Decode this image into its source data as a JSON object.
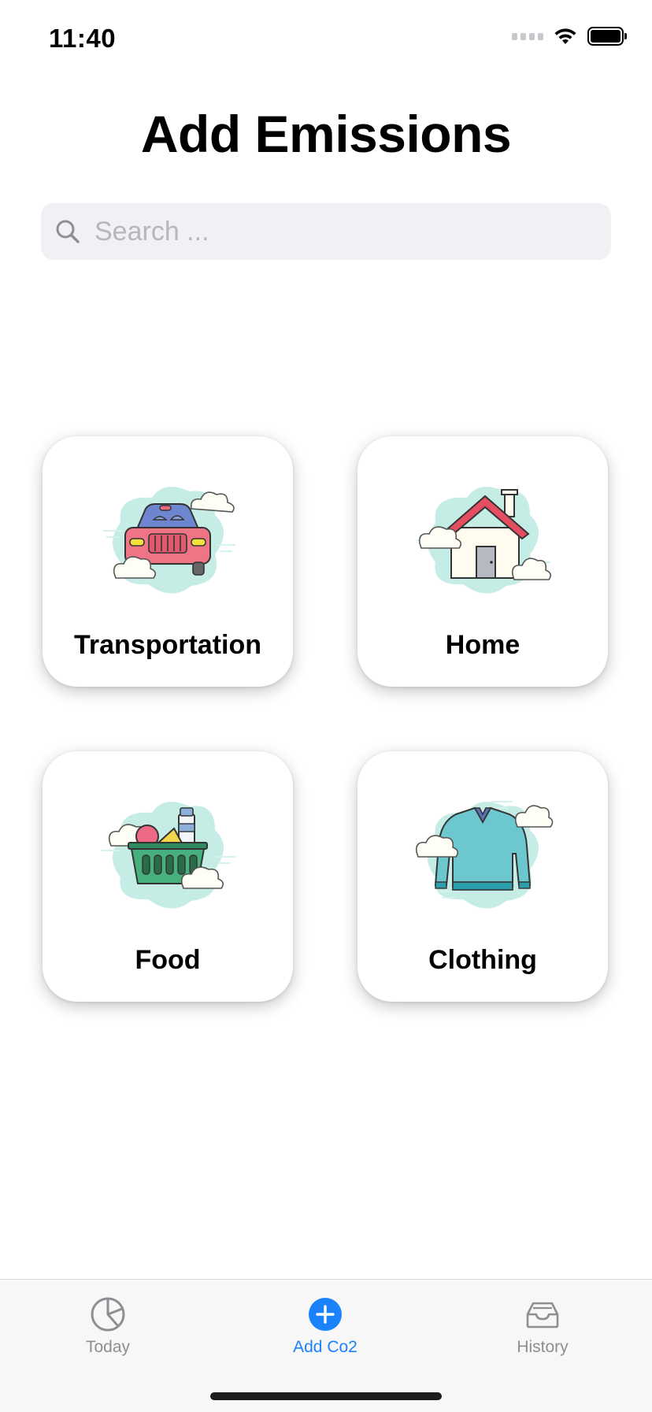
{
  "status_bar": {
    "time": "11:40"
  },
  "page": {
    "title": "Add Emissions"
  },
  "search": {
    "placeholder": "Search ...",
    "value": ""
  },
  "categories": [
    {
      "label": "Transportation",
      "icon": "car-icon"
    },
    {
      "label": "Home",
      "icon": "house-icon"
    },
    {
      "label": "Food",
      "icon": "grocery-basket-icon"
    },
    {
      "label": "Clothing",
      "icon": "sweater-icon"
    }
  ],
  "tab_bar": {
    "tabs": [
      {
        "label": "Today",
        "icon": "pie-chart-icon",
        "active": false
      },
      {
        "label": "Add Co2",
        "icon": "plus-circle-icon",
        "active": true
      },
      {
        "label": "History",
        "icon": "inbox-tray-icon",
        "active": false
      }
    ]
  },
  "colors": {
    "accent": "#1a82fb",
    "inactive": "#8e8e93",
    "search_bg": "#f0f0f5",
    "cloud_mint": "#c6ece6"
  }
}
